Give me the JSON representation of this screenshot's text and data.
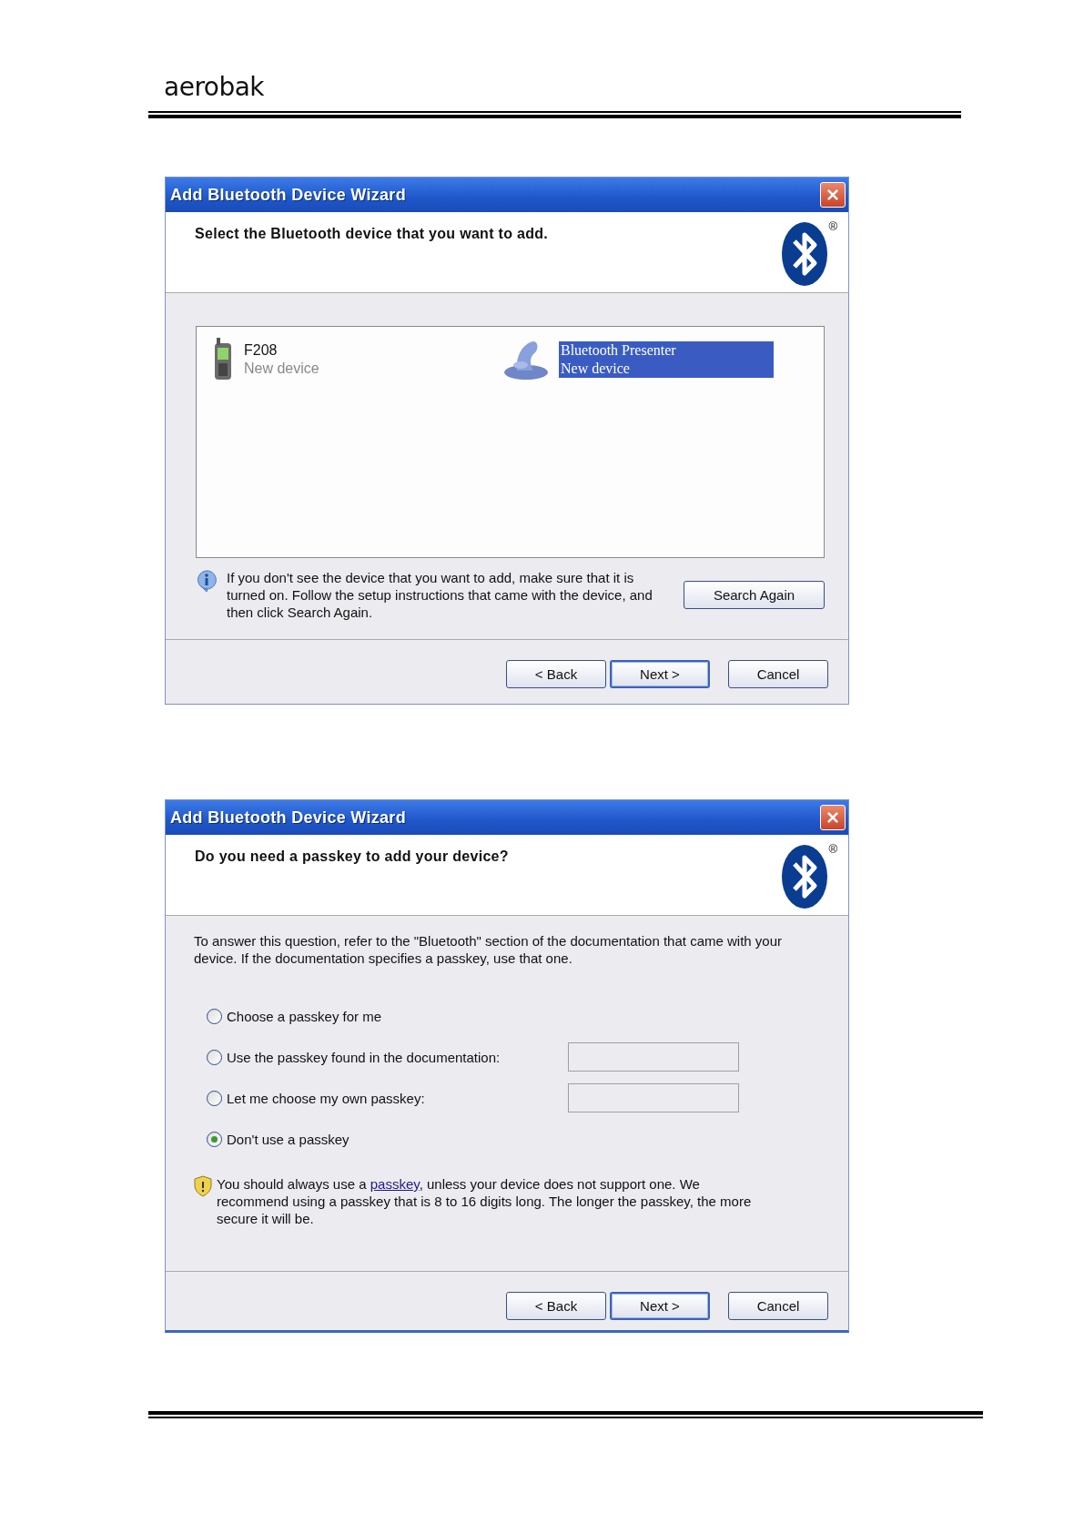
{
  "page_header": {
    "logo": "aerobak"
  },
  "windows": [
    {
      "kind": "device_select",
      "title": "Add Bluetooth Device Wizard",
      "heading": "Select the Bluetooth device that you want to add.",
      "registered_mark": "®",
      "devices": [
        {
          "kind": "phone",
          "name": "F208",
          "status": "New device",
          "selected": false
        },
        {
          "kind": "presenter",
          "name": "Bluetooth Presenter",
          "status": "New device",
          "selected": true
        }
      ],
      "info_text": "If you don't see the device that you want to add, make sure that it is turned on. Follow the setup instructions that came with the device, and then click Search Again.",
      "search_button": "Search Again",
      "buttons": [
        {
          "label": "< Back",
          "default": false
        },
        {
          "label": "Next >",
          "default": true
        },
        {
          "label": "Cancel",
          "default": false
        }
      ]
    },
    {
      "kind": "passkey",
      "title": "Add Bluetooth Device Wizard",
      "heading": "Do you need a passkey to add your device?",
      "registered_mark": "®",
      "intro": "To answer this question, refer to the \"Bluetooth\" section of the documentation that came with your device. If the documentation specifies a passkey, use that one.",
      "options": [
        {
          "kind": "plain",
          "label": "Choose a passkey for me",
          "selected": false
        },
        {
          "kind": "with_field",
          "label": "Use the passkey found in the documentation:",
          "selected": false
        },
        {
          "kind": "with_field",
          "label": "Let me choose my own passkey:",
          "selected": false
        },
        {
          "kind": "plain",
          "label": "Don't use a passkey",
          "selected": true
        }
      ],
      "warning": {
        "before": "You should always use a ",
        "link": "passkey",
        "after": ", unless your device does not support one. We recommend using a passkey that is 8 to 16 digits long. The longer the passkey, the more secure it will be."
      },
      "buttons": [
        {
          "label": "< Back",
          "default": false
        },
        {
          "label": "Next >",
          "default": true
        },
        {
          "label": "Cancel",
          "default": false
        }
      ]
    }
  ]
}
